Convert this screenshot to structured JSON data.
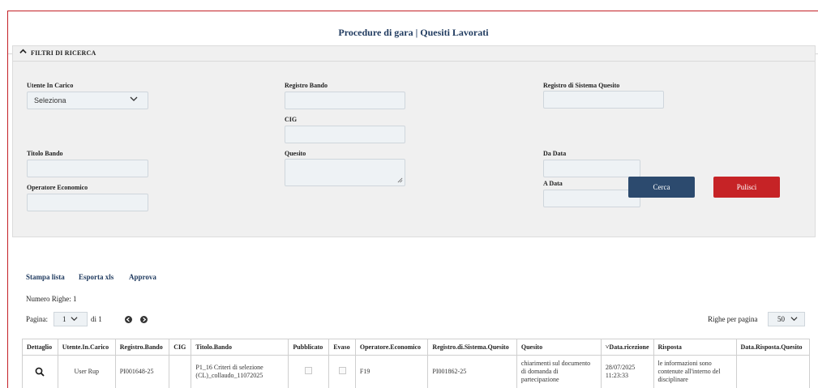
{
  "header": {
    "title": "Procedure di gara | Quesiti Lavorati"
  },
  "filters": {
    "section_title": "FILTRI DI RICERCA",
    "utente_label": "Utente In Carico",
    "utente_value": "Seleziona",
    "registro_bando_label": "Registro Bando",
    "registro_sistema_label": "Registro di Sistema Quesito",
    "cig_label": "CIG",
    "titolo_label": "Titolo Bando",
    "quesito_label": "Quesito",
    "da_data_label": "Da Data",
    "operatore_label": "Operatore Economico",
    "a_data_label": "A Data",
    "search_button": "Cerca",
    "clear_button": "Pulisci"
  },
  "actions": {
    "print": "Stampa lista",
    "export": "Esporta xls",
    "approve": "Approva"
  },
  "list_info": {
    "row_count": "Numero Righe: 1",
    "page_label": "Pagina:",
    "page_value": "1",
    "page_total": "di 1",
    "rows_per_page_label": "Righe per pagina",
    "rows_per_page_value": "50"
  },
  "table": {
    "headers": [
      "Dettaglio",
      "Utente.In.Carico",
      "Registro.Bando",
      "CIG",
      "Titolo.Bando",
      "Pubblicato",
      "Evaso",
      "Operatore.Economico",
      "Registro.di.Sistema.Quesito",
      "Quesito",
      "˅Data.ricezione",
      "Risposta",
      "Data.Risposta.Quesito"
    ],
    "rows": [
      {
        "utente": "User Rup",
        "registro_bando": "PI001648-25",
        "cig": "",
        "titolo": "P1_16 Criteri di selezione (CL)_collaudo_11072025",
        "operatore": "F19",
        "registro_sistema": "PI001862-25",
        "quesito": "chiarimenti sul documento di domanda di partecipazione",
        "data_ricezione": "28/07/2025 11:23:33",
        "risposta": "le informazioni sono contenute all'interno del disciplinare",
        "data_risposta": ""
      }
    ]
  },
  "icons": {
    "collapse": "chevron-up-icon",
    "dropdown": "chevron-down-icon",
    "prev": "arrow-left-circle-icon",
    "next": "arrow-right-circle-icon",
    "detail": "search-icon"
  },
  "colors": {
    "frame_accent": "#c32026",
    "primary_button": "#2c4a6e",
    "danger_button": "#c62326",
    "title_text": "#1f3a5f"
  }
}
